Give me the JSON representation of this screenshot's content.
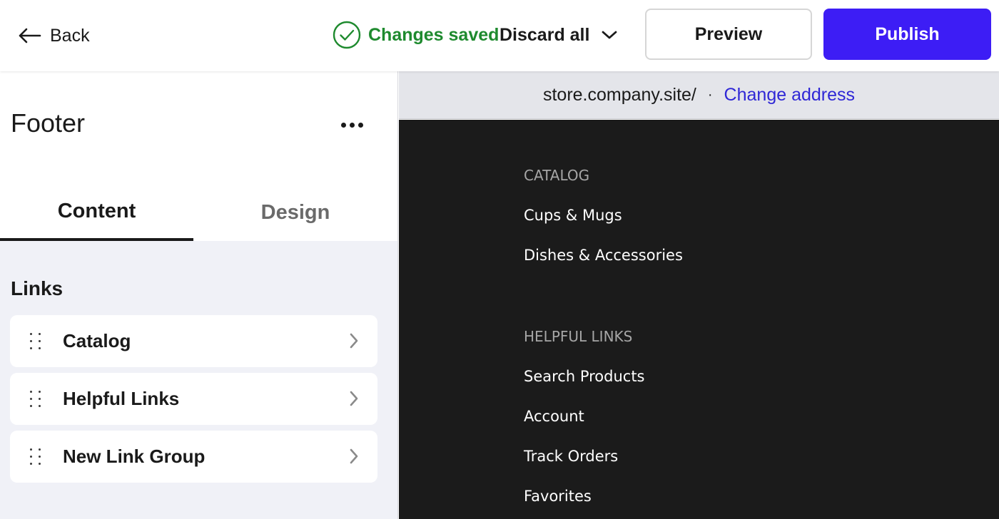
{
  "topbar": {
    "back_label": "Back",
    "status_label": "Changes saved",
    "discard_label": "Discard all",
    "preview_label": "Preview",
    "publish_label": "Publish"
  },
  "panel": {
    "title": "Footer",
    "tabs": [
      {
        "label": "Content",
        "active": true
      },
      {
        "label": "Design",
        "active": false
      }
    ],
    "links_title": "Links",
    "groups": [
      {
        "label": "Catalog"
      },
      {
        "label": "Helpful Links"
      },
      {
        "label": "New Link Group"
      }
    ]
  },
  "address_bar": {
    "url": "store.company.site/",
    "separator": "·",
    "change_label": "Change address"
  },
  "footer_preview": {
    "sections": [
      {
        "heading": "CATALOG",
        "links": [
          "Cups & Mugs",
          "Dishes & Accessories"
        ]
      },
      {
        "heading": "HELPFUL LINKS",
        "links": [
          "Search Products",
          "Account",
          "Track Orders",
          "Favorites"
        ]
      }
    ]
  },
  "colors": {
    "accent": "#3d1df5",
    "success": "#1e8a2e",
    "link": "#2f27d6",
    "preview_bg": "#1b1b1b"
  },
  "icons": [
    "arrow-left-icon",
    "check-circle-icon",
    "chevron-down-icon",
    "more-horizontal-icon",
    "drag-handle-icon",
    "chevron-right-icon"
  ]
}
